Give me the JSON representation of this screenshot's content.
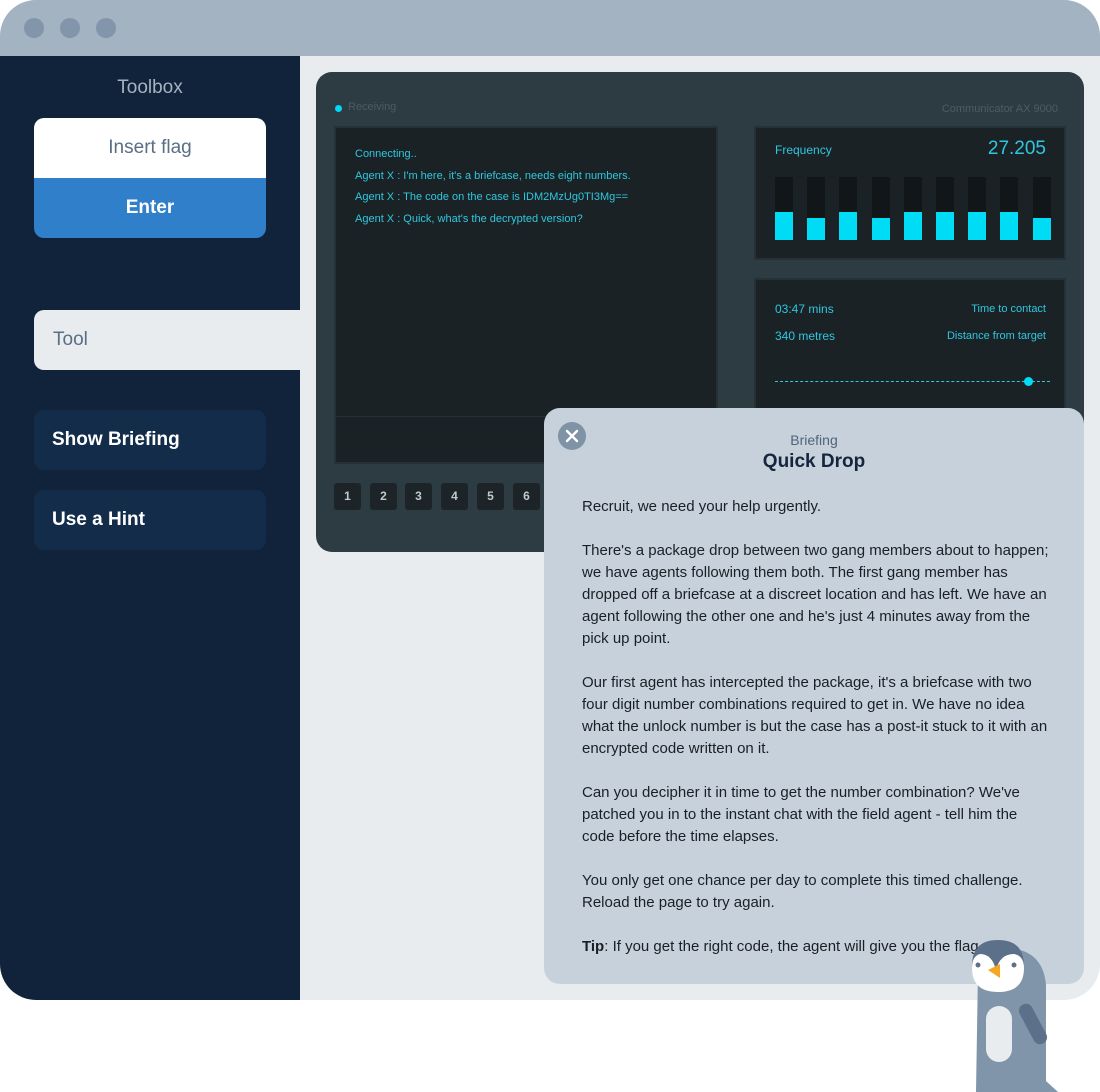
{
  "window": {
    "controls": [
      "close-dot",
      "minimize-dot",
      "maximize-dot"
    ]
  },
  "sidebar": {
    "title": "Toolbox",
    "flag_input": {
      "placeholder": "Insert flag",
      "value": ""
    },
    "enter_label": "Enter",
    "active_tab": "Tool",
    "buttons": [
      {
        "label": "Show Briefing"
      },
      {
        "label": "Use a Hint"
      }
    ]
  },
  "device": {
    "status": "Receiving",
    "name": "Communicator AX 9000",
    "chat": [
      "Connecting..",
      "Agent X  :  I'm here, it's a briefcase, needs eight numbers.",
      "Agent X  :  The code on the case is IDM2MzUg0TI3Mg==",
      "Agent X  :  Quick, what's the decrypted version?"
    ],
    "keypad": [
      "1",
      "2",
      "3",
      "4",
      "5",
      "6"
    ],
    "frequency": {
      "label": "Frequency",
      "value": "27.205",
      "levels": [
        0.45,
        0.35,
        0.45,
        0.35,
        0.45,
        0.45,
        0.45,
        0.45,
        0.35
      ]
    },
    "readouts": [
      {
        "value": "03:47 mins",
        "label": "Time to contact"
      },
      {
        "value": "340 metres",
        "label": "Distance from target"
      }
    ],
    "progress": 0.92,
    "colors": {
      "accent": "#00dcf6",
      "text": "#2fc7df"
    }
  },
  "briefing": {
    "subtitle": "Briefing",
    "title": "Quick Drop",
    "paragraphs": [
      "Recruit, we need your help urgently.",
      "There's a package drop between two gang members about to happen; we have agents following them both. The first gang member has dropped off a briefcase at a discreet location and has left. We have an agent following the other one and he's just 4 minutes away from the pick up point.",
      "Our first agent has intercepted the package, it's a briefcase with two four digit number combinations required to get in. We have no idea what the unlock number is but the case has a post-it stuck to it with an encrypted code written on it.",
      "Can you decipher it in time to get the number combination? We've patched you in to the instant chat with the field agent - tell him the code before the time elapses.",
      "You only get one chance per day to complete this timed challenge. Reload the page to try again."
    ],
    "tip_label": "Tip",
    "tip_text": ": If you get the right code, the agent will give you the flag."
  }
}
